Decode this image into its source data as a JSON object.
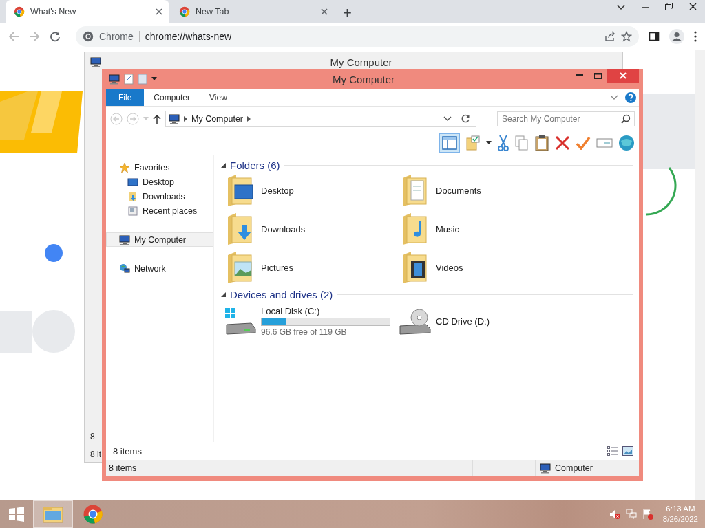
{
  "browser": {
    "tabs": [
      {
        "title": "What's New",
        "selected": true
      },
      {
        "title": "New Tab",
        "selected": false
      }
    ],
    "new_tab": "+",
    "address": {
      "chip": "Chrome",
      "url": "chrome://whats-new"
    }
  },
  "back_window": {
    "title": "My Computer",
    "row_text": "8",
    "status": "8 it"
  },
  "window": {
    "title": "My Computer",
    "ribbon_tabs": [
      {
        "label": "File",
        "selected": true
      },
      {
        "label": "Computer",
        "selected": false
      },
      {
        "label": "View",
        "selected": false
      }
    ],
    "breadcrumb": "My Computer",
    "search": {
      "placeholder": "Search My Computer"
    },
    "sidebar": [
      {
        "label": "Favorites",
        "kind": "star",
        "selected": false,
        "children": [
          {
            "label": "Desktop",
            "kind": "desktop",
            "selected": false
          },
          {
            "label": "Downloads",
            "kind": "downloads",
            "selected": false
          },
          {
            "label": "Recent places",
            "kind": "recent",
            "selected": false
          }
        ]
      },
      {
        "label": "My Computer",
        "kind": "computer",
        "selected": true
      },
      {
        "label": "Network",
        "kind": "network",
        "selected": false
      }
    ],
    "folders": {
      "title": "Folders (6)",
      "items": [
        {
          "name": "Desktop",
          "kind": "desktop"
        },
        {
          "name": "Documents",
          "kind": "documents"
        },
        {
          "name": "Downloads",
          "kind": "downloads"
        },
        {
          "name": "Music",
          "kind": "music"
        },
        {
          "name": "Pictures",
          "kind": "pictures"
        },
        {
          "name": "Videos",
          "kind": "videos"
        }
      ]
    },
    "drives": {
      "title": "Devices and drives (2)",
      "items": [
        {
          "name": "Local Disk (C:)",
          "kind": "disk",
          "level": 0.19,
          "free": "96.6 GB free of 119 GB"
        },
        {
          "name": "CD Drive (D:)",
          "kind": "cd"
        }
      ]
    },
    "footer_count": "8 items",
    "status_bar": {
      "items": "8 items",
      "location": "Computer"
    }
  },
  "taskbar": {
    "time": "6:13 AM",
    "date": "8/26/2022"
  }
}
